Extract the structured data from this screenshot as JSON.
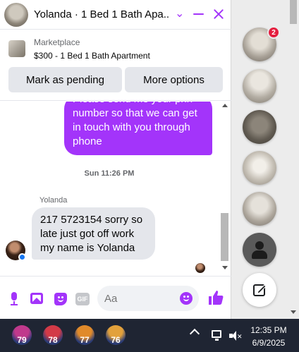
{
  "chat": {
    "title": "Yolanda · 1 Bed 1 Bath Apa...",
    "listing": {
      "label": "Marketplace",
      "title": "$300 - 1 Bed 1 Bath Apartment",
      "mark_pending_label": "Mark as pending",
      "more_options_label": "More options"
    },
    "messages": {
      "outgoing_text": "Please send me your phn number so that we can get in touch with you through phone",
      "timestamp": "Sun 11:26 PM",
      "sender_name": "Yolanda",
      "incoming_text": "217 5723154 sorry so late just got off work my name is Yolanda"
    },
    "composer": {
      "gif_label": "GIF",
      "placeholder": "Aa"
    }
  },
  "rail": {
    "notification_count": "2"
  },
  "taskbar": {
    "apps": [
      "79",
      "78",
      "77",
      "76"
    ],
    "time": "12:35 PM",
    "date": "6/9/2025"
  },
  "colors": {
    "accent": "#a334fa",
    "bubble_in": "#e4e6eb",
    "badge": "#e41e3f",
    "taskbar": "#1f2533"
  },
  "icons": [
    "chevron-down-icon",
    "minimize-icon",
    "close-icon",
    "microphone-icon",
    "photo-icon",
    "sticker-icon",
    "gif-icon",
    "emoji-icon",
    "thumbs-up-icon",
    "new-message-icon",
    "chevron-up-icon",
    "network-icon",
    "volume-muted-icon"
  ]
}
